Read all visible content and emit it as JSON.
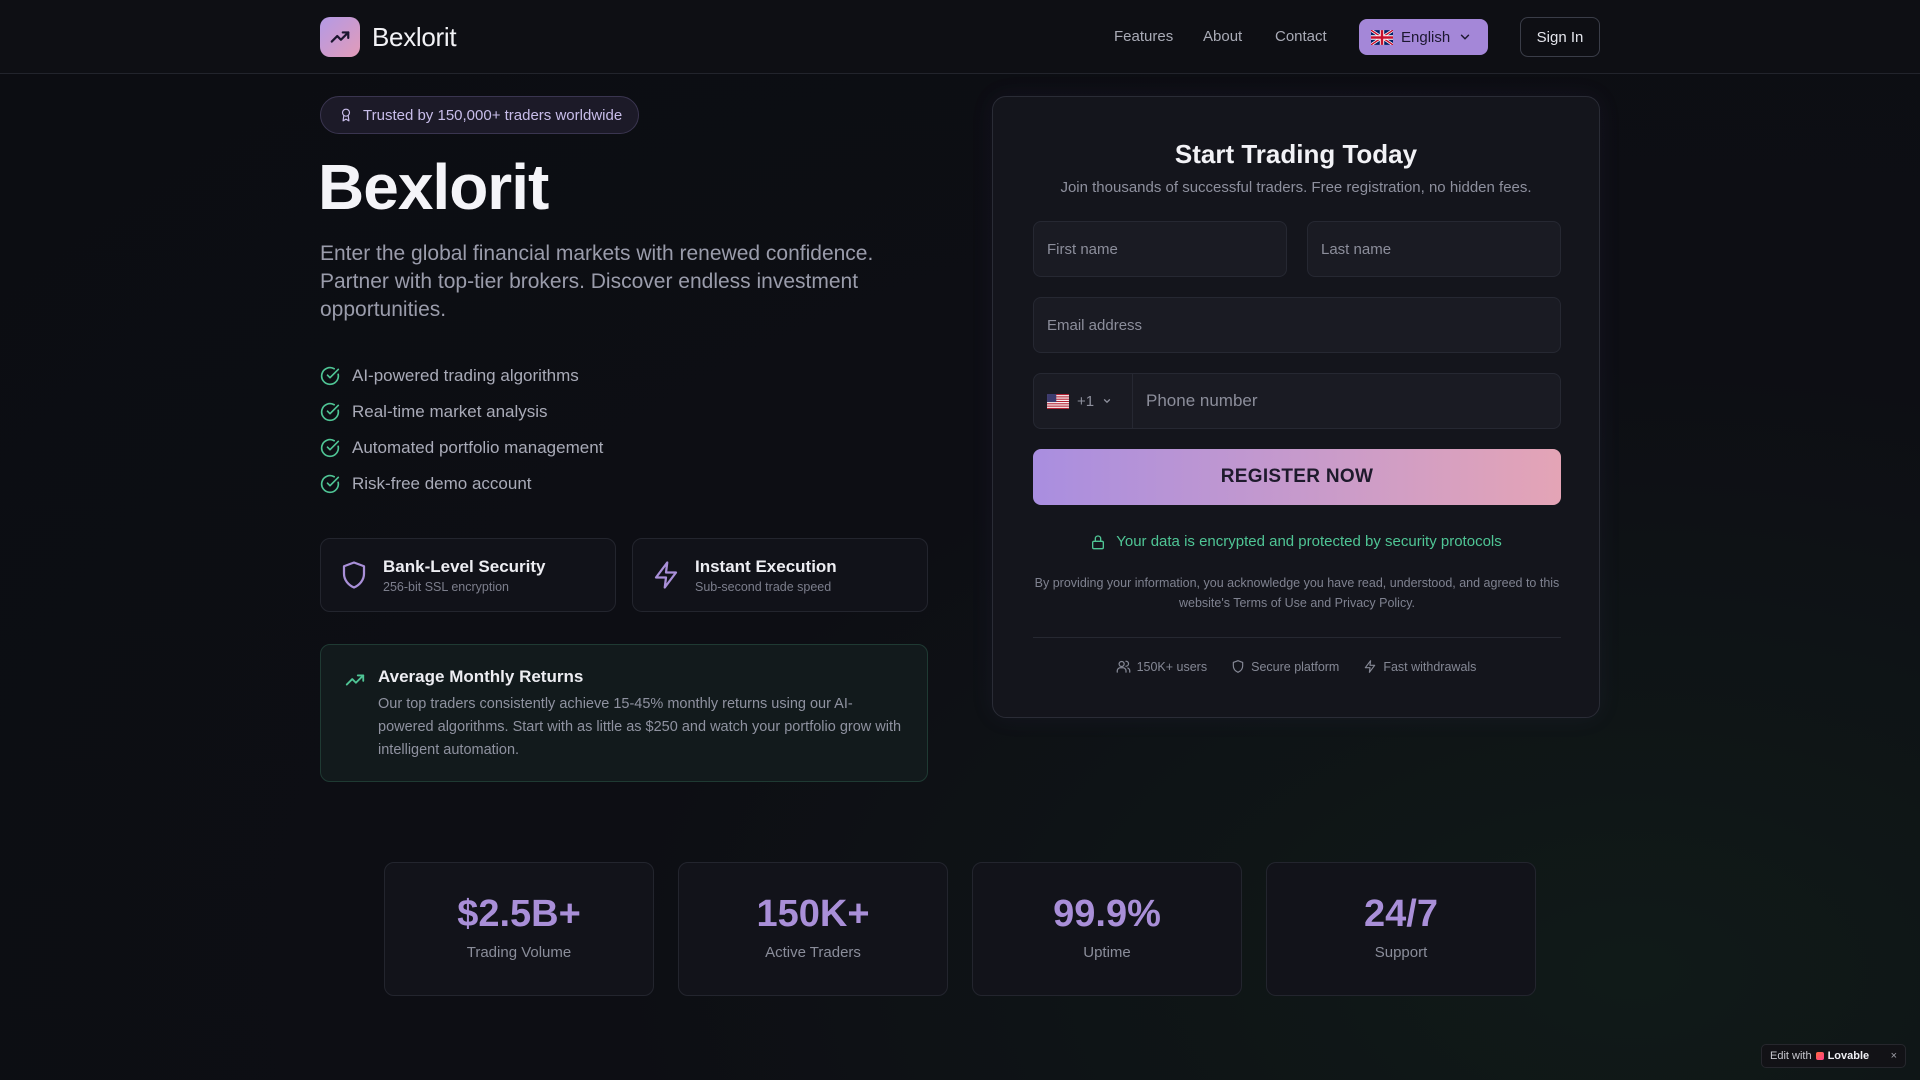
{
  "nav": {
    "brand": "Bexlorit",
    "links": [
      "Features",
      "About",
      "Contact"
    ],
    "language": "English",
    "sign_in": "Sign In"
  },
  "hero": {
    "badge": "Trusted by 150,000+ traders worldwide",
    "title": "Bexlorit",
    "subtitle": "Enter the global financial markets with renewed confidence. Partner with top-tier brokers. Discover endless investment opportunities.",
    "features": [
      "AI-powered trading algorithms",
      "Real-time market analysis",
      "Automated portfolio management",
      "Risk-free demo account"
    ],
    "cards": [
      {
        "title": "Bank-Level Security",
        "subtitle": "256-bit SSL encryption",
        "icon": "shield-icon"
      },
      {
        "title": "Instant Execution",
        "subtitle": "Sub-second trade speed",
        "icon": "lightning-icon"
      }
    ],
    "returns": {
      "title": "Average Monthly Returns",
      "body": "Our top traders consistently achieve 15-45% monthly returns using our AI-powered algorithms. Start with as little as $250 and watch your portfolio grow with intelligent automation."
    }
  },
  "form": {
    "title": "Start Trading Today",
    "subtitle": "Join thousands of successful traders. Free registration, no hidden fees.",
    "first_name_placeholder": "First name",
    "last_name_placeholder": "Last name",
    "email_placeholder": "Email address",
    "phone_code": "+1",
    "phone_placeholder": "Phone number",
    "submit": "REGISTER NOW",
    "secure_note": "Your data is encrypted and protected by security protocols",
    "legal": "By providing your information, you acknowledge you have read, understood, and agreed to this website's Terms of Use and Privacy Policy.",
    "footer": [
      "150K+ users",
      "Secure platform",
      "Fast withdrawals"
    ]
  },
  "stats": [
    {
      "value": "$2.5B+",
      "label": "Trading Volume"
    },
    {
      "value": "150K+",
      "label": "Active Traders"
    },
    {
      "value": "99.9%",
      "label": "Uptime"
    },
    {
      "value": "24/7",
      "label": "Support"
    }
  ],
  "lovable": {
    "prefix": "Edit with",
    "brand": "Lovable",
    "close": "×"
  },
  "colors": {
    "accent": "#a98fd8",
    "success": "#4fc595",
    "background": "#0d0e14"
  }
}
